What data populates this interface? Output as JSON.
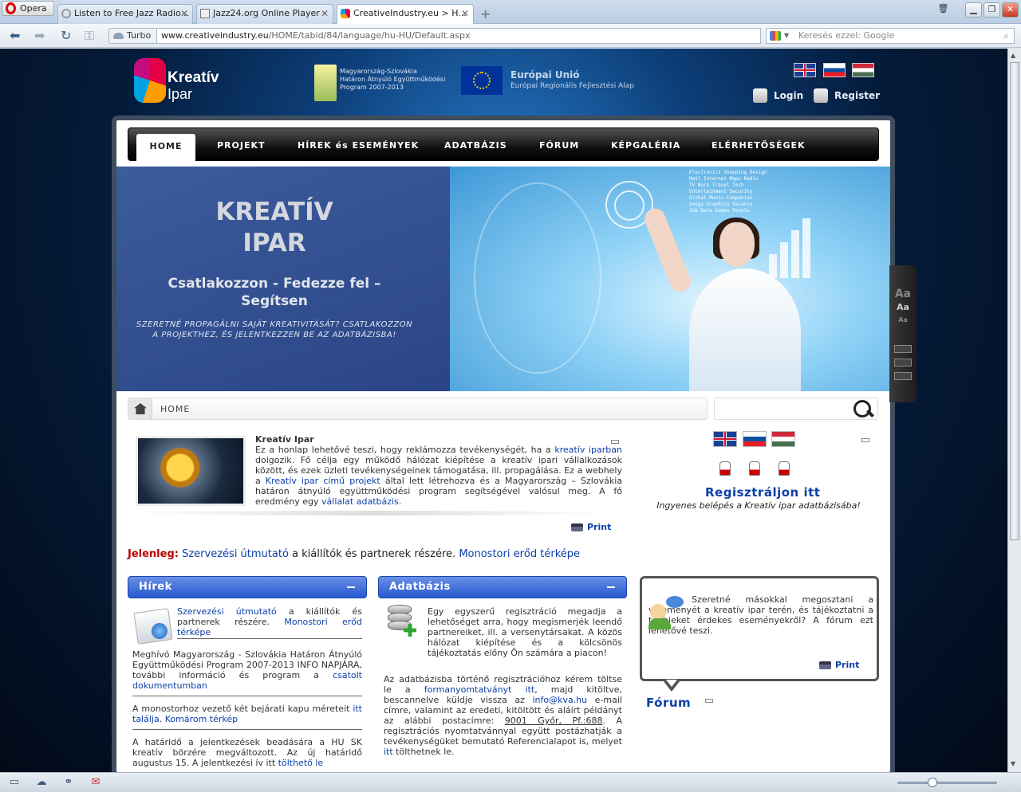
{
  "browser": {
    "opera_label": "Opera",
    "tabs": [
      {
        "title": "Listen to Free Jazz Radio..."
      },
      {
        "title": "Jazz24.org Online Player"
      },
      {
        "title": "CreativeIndustry.eu > H..."
      }
    ],
    "turbo_label": "Turbo",
    "url_domain": "www.creativeindustry.eu",
    "url_path": "/HOME/tabid/84/language/hu-HU/Default.aspx",
    "search_placeholder": "Keresés ezzel: Google"
  },
  "header": {
    "logo_line1": "Kreatív",
    "logo_line2": "Ipar",
    "huskprog": [
      "Magyarország-Szlovákia",
      "Határon Átnyúló Együttműködési",
      "Program 2007-2013"
    ],
    "eu_title": "Európai Unió",
    "eu_sub": "Európai Regionális Fejlesztési Alap",
    "login_label": "Login",
    "register_label": "Register"
  },
  "menu": [
    "HOME",
    "PROJEKT",
    "HÍREK és ESEMÉNYEK",
    "ADATBÁZIS",
    "FÓRUM",
    "KÉPGALÉRIA",
    "ELÉRHETŐSÉGEK"
  ],
  "banner": {
    "title_line1": "KREATÍV",
    "title_line2": "IPAR",
    "slogan_line1": "Csatlakozzon - Fedezze fel –",
    "slogan_line2": "Segítsen",
    "cta": "SZERETNÉ PROPAGÁLNI SAJÁT KREATIVITÁSÁT? CSATLAKOZZON A PROJEKTHEZ, ÉS JELENTKEZZEN BE AZ ADATBÁZISBA!",
    "screen_text": [
      "Electronics Shopping Design",
      "Mail Internet Maps Radio",
      "TV Work Travel Tech",
      "Entertainment Security",
      "Global Music Companies",
      "Songs Graphics Vacancy",
      "Job Data Games People"
    ]
  },
  "tools": {
    "a1": "Aa",
    "a2": "Aa",
    "a3": "Aa"
  },
  "breadcrumb": {
    "label": "HOME"
  },
  "intro": {
    "title": "Kreatív Ipar",
    "p1": "Ez a honlap lehetővé teszi, hogy reklámozza tevékenységét, ha a ",
    "l1": "kreatív iparban",
    "p2": " dolgozik. Fő célja egy működő hálózat kiépítése a kreatív ipari vállalkozások között, és ezek üzleti tevékenységeinek támogatása, ill. propagálása. Ez a webhely a ",
    "l2": "Kreatív ipar című projekt",
    "p3": " által lett létrehozva és a Magyarország – Szlovákia határon átnyúló együttműködési program segítségével valósul meg. A fő eredmény egy ",
    "l3": "vállalat adatbázis",
    "p4": ".",
    "print": "Print"
  },
  "register": {
    "title": "Regisztráljon itt",
    "subtitle": "Ingyenes belépés a Kreatív ipar adatbázisába!"
  },
  "jelenleg": {
    "label": "Jelenleg:",
    "l1": "Szervezési útmutató",
    "mid": " a kiállítók és partnerek részére. ",
    "l2": "Monostori erőd térképe"
  },
  "hirek": {
    "header": "Hírek",
    "item1_l1": "Szervezési útmutató",
    "item1_t": " a kiállítók és partnerek részére. ",
    "item1_l2": "Monostori erőd térképe",
    "item2_t": "Meghívó Magyarország - Szlovákia Határon Átnyúló Együttműködési Program 2007-2013 INFO NAPJÁRA, további információ és program a ",
    "item2_l": "csatolt dokumentumban",
    "item3_t": "A monostorhoz vezető két bejárati kapu méreteit ",
    "item3_l1": "itt találja",
    "item3_m": ". ",
    "item3_l2": "Komárom térkép",
    "item4_t": "A határidő a jelentkezések beadására a HU SK kreatív börzére megváltozott. Az új határidő augustus 15. A jelentkezési ív itt ",
    "item4_l": "tölthető le"
  },
  "adatbazis": {
    "header": "Adatbázis",
    "p1": "Egy egyszerű regisztráció megadja a lehetőséget arra, hogy megismerjék leendő partnereiket, ill. a versenytársakat. A közös hálózat kiépítése és a kölcsönös tájékoztatás előny Ön számára a piacon!",
    "p2a": "Az adatbázisba történő regisztrációhoz kérem töltse le a ",
    "p2l1": "formanyomtatványt itt",
    "p2b": ", majd kitöltve, bescannelve küldje vissza az ",
    "p2l2": "info@kva.hu",
    "p2c": " e-mail címre, valamint az eredeti, kitöltött és aláírt példányt az alábbi postacímre: ",
    "p2u": "9001 Győr, Pf.:688",
    "p2d": ". A regisztrációs nyomtatvánnyal együtt postázhatják a tevékenységüket bemutató Referencialapot is, melyet ",
    "p2l3": "itt",
    "p2e": " tölthetnek le."
  },
  "forum": {
    "text": "Szeretné másokkal megosztani a véleményét a kreatív ipar terén, és tájékoztatni a többieket érdekes eseményekről? A fórum ezt lehetővé teszi.",
    "print": "Print",
    "label": "Fórum"
  },
  "colors": {
    "link": "#0b3fa8",
    "header_blue": "#2658cf",
    "jelenleg_red": "#b00000"
  }
}
